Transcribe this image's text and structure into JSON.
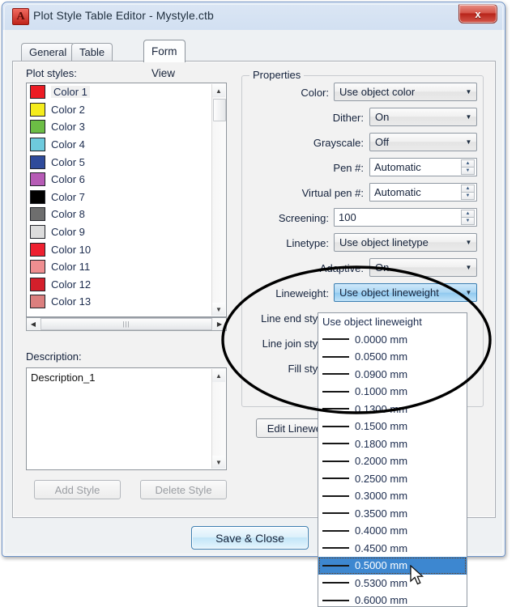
{
  "window": {
    "title": "Plot Style Table Editor - Mystyle.ctb",
    "app_icon": "autocad-a-icon",
    "close_label": "x"
  },
  "tabs": [
    {
      "label": "General",
      "active": false
    },
    {
      "label": "Table View",
      "active": false
    },
    {
      "label": "Form View",
      "active": true
    }
  ],
  "plot_styles": {
    "label": "Plot styles:",
    "selected_index": 0,
    "items": [
      {
        "name": "Color 1",
        "color": "#ec1c24"
      },
      {
        "name": "Color 2",
        "color": "#f5ec1c"
      },
      {
        "name": "Color 3",
        "color": "#6cbd45"
      },
      {
        "name": "Color 4",
        "color": "#6ecadd"
      },
      {
        "name": "Color 5",
        "color": "#2f4b9b"
      },
      {
        "name": "Color 6",
        "color": "#b martin"
      },
      {
        "name": "Color 7",
        "color": "#000000"
      },
      {
        "name": "Color 8",
        "color": "#6e6e6e"
      },
      {
        "name": "Color 9",
        "color": "#dcdcdc"
      },
      {
        "name": "Color 10",
        "color": "#ee2030"
      },
      {
        "name": "Color 11",
        "color": "#ef8e90"
      },
      {
        "name": "Color 12",
        "color": "#d41f2b"
      },
      {
        "name": "Color 13",
        "color": "#db7f7e"
      }
    ]
  },
  "description": {
    "label": "Description:",
    "value": "Description_1"
  },
  "style_buttons": {
    "add": "Add Style",
    "delete": "Delete Style"
  },
  "properties": {
    "group_title": "Properties",
    "fields": [
      {
        "label": "Color:",
        "value": "Use object color",
        "type": "combo"
      },
      {
        "label": "Dither:",
        "value": "On",
        "type": "combo"
      },
      {
        "label": "Grayscale:",
        "value": "Off",
        "type": "combo"
      },
      {
        "label": "Pen #:",
        "value": "Automatic",
        "type": "spin"
      },
      {
        "label": "Virtual pen #:",
        "value": "Automatic",
        "type": "spin"
      },
      {
        "label": "Screening:",
        "value": "100",
        "type": "spin"
      },
      {
        "label": "Linetype:",
        "value": "Use object linetype",
        "type": "combo"
      },
      {
        "label": "Adaptive:",
        "value": "On",
        "type": "combo"
      },
      {
        "label": "Lineweight:",
        "value": "Use object lineweight",
        "type": "combo-open"
      },
      {
        "label": "Line end style:",
        "value": "",
        "type": "combo-hidden"
      },
      {
        "label": "Line join style:",
        "value": "",
        "type": "combo-hidden"
      },
      {
        "label": "Fill style:",
        "value": "",
        "type": "combo-hidden"
      }
    ],
    "edit_lineweights_label": "Edit Lineweights..."
  },
  "lineweight_dropdown": {
    "selected": "0.5000 mm",
    "items": [
      {
        "text": "Use object lineweight",
        "swatch": false,
        "selected": false
      },
      {
        "text": "0.0000 mm",
        "swatch": true,
        "selected": false
      },
      {
        "text": "0.0500 mm",
        "swatch": true,
        "selected": false
      },
      {
        "text": "0.0900 mm",
        "swatch": true,
        "selected": false
      },
      {
        "text": "0.1000 mm",
        "swatch": true,
        "selected": false
      },
      {
        "text": "0.1300 mm",
        "swatch": true,
        "selected": false
      },
      {
        "text": "0.1500 mm",
        "swatch": true,
        "selected": false
      },
      {
        "text": "0.1800 mm",
        "swatch": true,
        "selected": false
      },
      {
        "text": "0.2000 mm",
        "swatch": true,
        "selected": false
      },
      {
        "text": "0.2500 mm",
        "swatch": true,
        "selected": false
      },
      {
        "text": "0.3000 mm",
        "swatch": true,
        "selected": false
      },
      {
        "text": "0.3500 mm",
        "swatch": true,
        "selected": false
      },
      {
        "text": "0.4000 mm",
        "swatch": true,
        "selected": false
      },
      {
        "text": "0.4500 mm",
        "swatch": true,
        "selected": false
      },
      {
        "text": "0.5000 mm",
        "swatch": true,
        "selected": true
      },
      {
        "text": "0.5300 mm",
        "swatch": true,
        "selected": false
      },
      {
        "text": "0.6000 mm",
        "swatch": true,
        "selected": false
      }
    ]
  },
  "footer": {
    "save_close": "Save & Close"
  },
  "annotation": {
    "shape": "ellipse-highlight",
    "color": "#000000"
  },
  "colors": {
    "accent_blue": "#3d87d0",
    "title_bar": "#d2e0f2",
    "dialog_bg": "#eef1f3",
    "close_red": "#b8241a"
  }
}
